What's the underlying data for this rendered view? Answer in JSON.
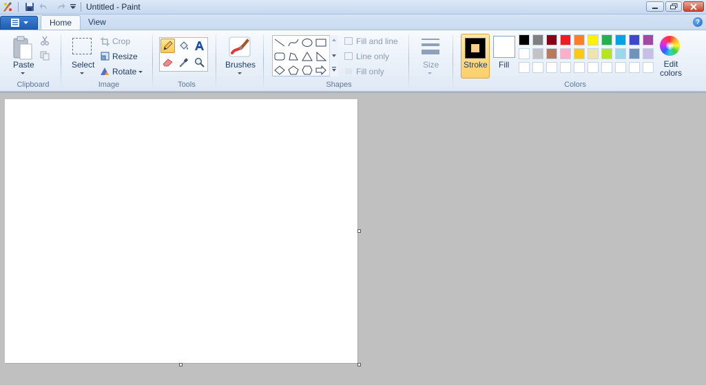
{
  "window": {
    "title": "Untitled - Paint"
  },
  "tabs": [
    {
      "label": "Home",
      "active": true
    },
    {
      "label": "View",
      "active": false
    }
  ],
  "clipboard": {
    "group_label": "Clipboard",
    "paste_label": "Paste"
  },
  "image": {
    "group_label": "Image",
    "select_label": "Select",
    "crop_label": "Crop",
    "resize_label": "Resize",
    "rotate_label": "Rotate"
  },
  "tools": {
    "group_label": "Tools",
    "selected": "pencil"
  },
  "brushes": {
    "label": "Brushes"
  },
  "shapes": {
    "group_label": "Shapes",
    "fill_and_line": "Fill and line",
    "line_only": "Line only",
    "fill_only": "Fill only"
  },
  "size": {
    "label": "Size"
  },
  "colors": {
    "group_label": "Colors",
    "stroke_label": "Stroke",
    "fill_label": "Fill",
    "edit_label": "Edit colors",
    "stroke_color": "#000000",
    "fill_color": "#ffffff",
    "palette_row1": [
      "#000000",
      "#7f7f7f",
      "#880015",
      "#ed1c24",
      "#ff7f27",
      "#fff200",
      "#22b14c",
      "#00a2e8",
      "#3f48cc",
      "#a349a4"
    ],
    "palette_row2": [
      "#ffffff",
      "#c3c3c3",
      "#b97a57",
      "#ffaec9",
      "#ffc90e",
      "#efe4b0",
      "#b5e61d",
      "#99d9ea",
      "#7092be",
      "#c8bfe7"
    ],
    "palette_row3": [
      "#ffffff",
      "#ffffff",
      "#ffffff",
      "#ffffff",
      "#ffffff",
      "#ffffff",
      "#ffffff",
      "#ffffff",
      "#ffffff",
      "#ffffff"
    ]
  }
}
